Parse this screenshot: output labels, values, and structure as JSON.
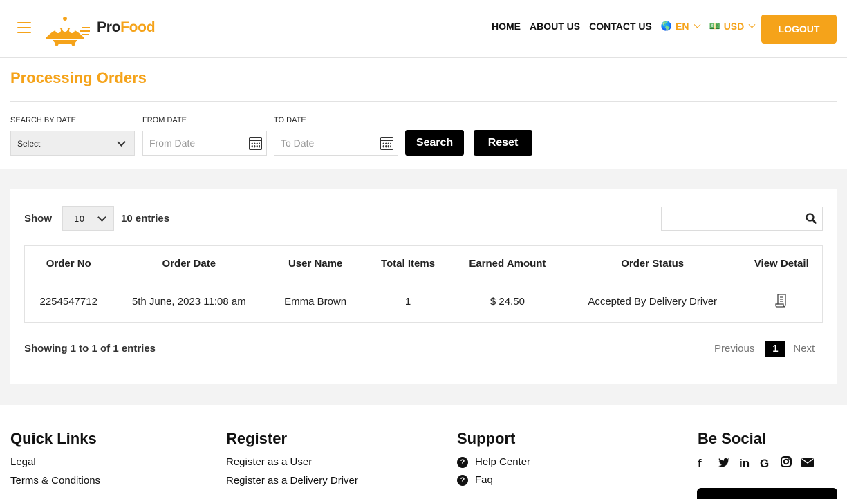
{
  "brand": {
    "pro": "Pro",
    "food": "Food",
    "accent": "#f5a31a"
  },
  "nav": {
    "home": "HOME",
    "about": "ABOUT US",
    "contact": "CONTACT US",
    "language": "EN",
    "currency": "USD",
    "logout": "LOGOUT"
  },
  "page": {
    "title": "Processing Orders"
  },
  "filter": {
    "search_by_date_label": "SEARCH BY DATE",
    "search_by_date_value": "Select",
    "from_date_label": "FROM DATE",
    "from_date_placeholder": "From Date",
    "to_date_label": "TO DATE",
    "to_date_placeholder": "To Date",
    "search_button": "Search",
    "reset_button": "Reset"
  },
  "table_controls": {
    "show_label": "Show",
    "page_length": "10",
    "entries_label": "10 entries"
  },
  "table": {
    "headers": [
      "Order No",
      "Order Date",
      "User Name",
      "Total Items",
      "Earned Amount",
      "Order Status",
      "View Detail"
    ],
    "rows": [
      {
        "order_no": "2254547712",
        "order_date": "5th June, 2023 11:08 am",
        "user_name": "Emma Brown",
        "total_items": "1",
        "earned_amount": "$ 24.50",
        "order_status": "Accepted By Delivery Driver",
        "view_icon": "document-icon"
      }
    ]
  },
  "pagination": {
    "info": "Showing 1 to 1 of 1 entries",
    "previous": "Previous",
    "current": "1",
    "next": "Next"
  },
  "footer": {
    "quick_links": {
      "title": "Quick Links",
      "items": [
        "Legal",
        "Terms & Conditions"
      ]
    },
    "register": {
      "title": "Register",
      "items": [
        "Register as a User",
        "Register as a Delivery Driver"
      ]
    },
    "support": {
      "title": "Support",
      "items": [
        "Help Center",
        "Faq"
      ]
    },
    "social": {
      "title": "Be Social",
      "icons": [
        "facebook-icon",
        "twitter-icon",
        "linkedin-icon",
        "google-icon",
        "instagram-icon",
        "envelope-icon"
      ]
    }
  }
}
